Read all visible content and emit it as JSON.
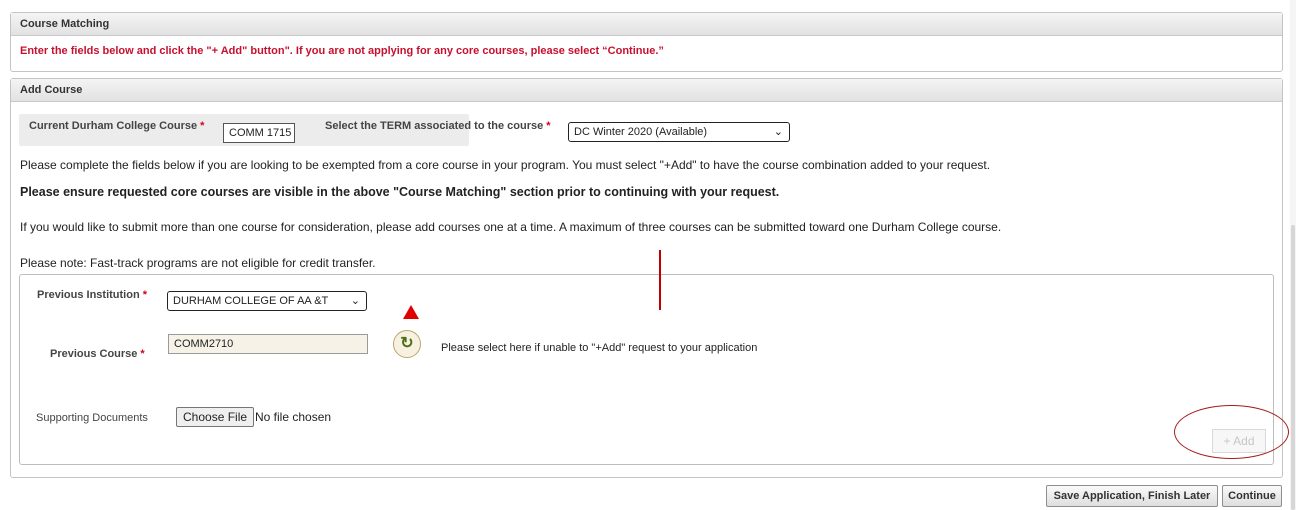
{
  "course_matching": {
    "title": "Course Matching",
    "instruction": "Enter the fields below and click the \"+ Add\" button\". If you are not applying for any core courses, please select “Continue.”"
  },
  "add_course": {
    "title": "Add Course",
    "current_course_label": "Current Durham College Course",
    "current_course_value": "COMM 1715",
    "term_label": "Select the TERM associated to the course",
    "term_value": "DC Winter 2020 (Available)",
    "required_mark": "*",
    "paragraphs": [
      "Please complete the fields below if you are looking to be exempted from a core course in your program. You must select \"+Add\" to have the course combination added to your request.",
      "Please ensure requested core courses are visible in the above \"Course Matching\" section prior to continuing with your request.",
      "If you would like to submit more than one course for consideration, please add courses one at a time. A maximum of three courses can be submitted toward one Durham College course.",
      "Please note: Fast-track programs are not eligible for credit transfer."
    ],
    "form": {
      "previous_institution_label": "Previous Institution",
      "previous_institution_value": "DURHAM COLLEGE OF AA &T",
      "previous_course_label": "Previous Course",
      "previous_course_value": "COMM2710",
      "refresh_hint": "Please select here if unable to \"+Add\" request to your application",
      "supporting_docs_label": "Supporting Documents",
      "choose_file_label": "Choose File",
      "no_file_text": "No file chosen",
      "add_label": "+ Add"
    }
  },
  "footer": {
    "save_later_label": "Save Application, Finish Later",
    "continue_label": "Continue"
  },
  "icons": {
    "refresh": "refresh-icon",
    "dropdown": "chevron-down-icon"
  },
  "colors": {
    "instruction_red": "#c8102e",
    "required_red": "#d0021b",
    "annotation_red": "#e00000"
  }
}
